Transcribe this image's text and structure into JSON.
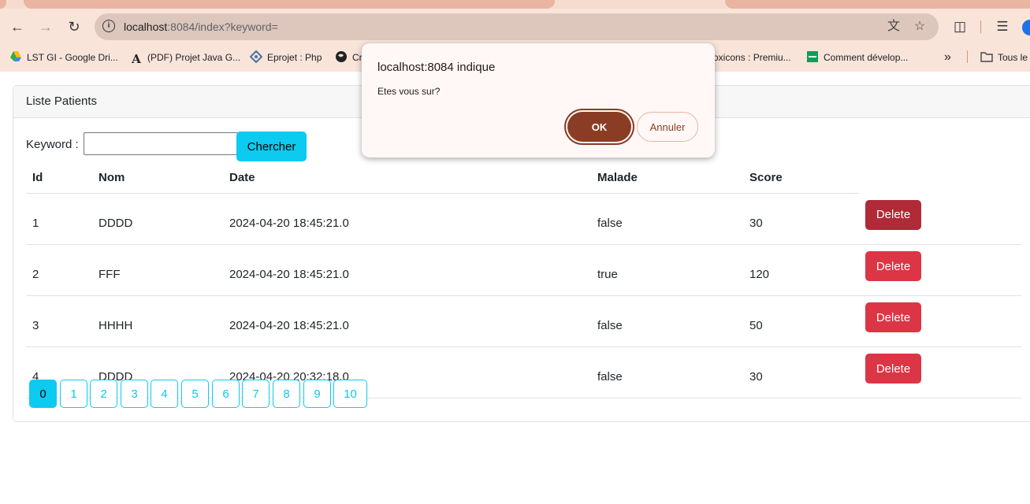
{
  "browser": {
    "url_host": "localhost",
    "url_rest": ":8084/index?keyword=",
    "bookmarks": [
      {
        "label": "LST GI - Google Dri...",
        "icon": "google-drive-icon"
      },
      {
        "label": "(PDF) Projet Java G...",
        "icon": "academia-icon"
      },
      {
        "label": "Eprojet : Php",
        "icon": "diamond-icon"
      },
      {
        "label": "Cr",
        "icon": "globe-icon"
      },
      {
        "label": "oxicons : Premiu...",
        "icon": ""
      },
      {
        "label": "Comment dévelop...",
        "icon": "green-doc-icon"
      },
      {
        "label": "Tous le",
        "icon": "folder-icon"
      }
    ],
    "more_bookmarks": "»"
  },
  "card": {
    "title": "Liste Patients"
  },
  "search": {
    "label": "Keyword :",
    "value": "",
    "button": "Chercher"
  },
  "table": {
    "headers": [
      "Id",
      "Nom",
      "Date",
      "Malade",
      "Score"
    ],
    "rows": [
      {
        "id": "1",
        "nom": "DDDD",
        "date": "2024-04-20 18:45:21.0",
        "malade": "false",
        "score": "30",
        "action": "Delete"
      },
      {
        "id": "2",
        "nom": "FFF",
        "date": "2024-04-20 18:45:21.0",
        "malade": "true",
        "score": "120",
        "action": "Delete"
      },
      {
        "id": "3",
        "nom": "HHHH",
        "date": "2024-04-20 18:45:21.0",
        "malade": "false",
        "score": "50",
        "action": "Delete"
      },
      {
        "id": "4",
        "nom": "DDDD",
        "date": "2024-04-20 20:32:18.0",
        "malade": "false",
        "score": "30",
        "action": "Delete"
      }
    ]
  },
  "pagination": {
    "pages": [
      "0",
      "1",
      "2",
      "3",
      "4",
      "5",
      "6",
      "7",
      "8",
      "9",
      "10"
    ],
    "current": "0"
  },
  "dialog": {
    "title": "localhost:8084 indique",
    "message": "Etes vous sur?",
    "ok": "OK",
    "cancel": "Annuler"
  },
  "colors": {
    "info": "#0dcaf0",
    "danger": "#dc3545",
    "dialog_accent": "#8a3d24"
  }
}
